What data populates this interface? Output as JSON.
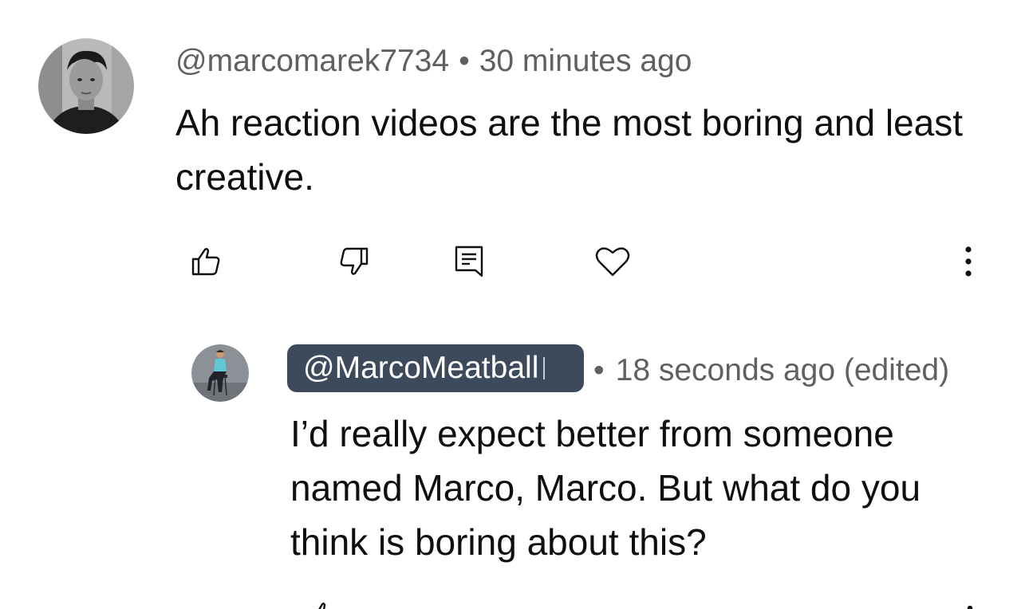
{
  "comment": {
    "author": "@marcomarek7734",
    "time": "30 minutes ago",
    "text": "Ah reaction videos are the most boring and least creative.",
    "avatar_icon": "avatar-photo-young-man",
    "actions": {
      "like_icon": "thumbs-up-icon",
      "dislike_icon": "thumbs-down-icon",
      "reply_icon": "comment-reply-icon",
      "heart_icon": "heart-icon",
      "more_icon": "more-vertical-icon"
    }
  },
  "reply": {
    "author": "@MarcoMeatball",
    "time": "18 seconds ago (edited)",
    "text": "I’d really expect better from someone named Marco, Marco. But what do you think is boring about this?",
    "avatar_icon": "avatar-photo-man-on-stool",
    "chip_color": "#3d4a5c"
  },
  "separator": "•",
  "colors": {
    "text_primary": "#0f0f0f",
    "text_secondary": "#606060",
    "background": "#ffffff"
  }
}
